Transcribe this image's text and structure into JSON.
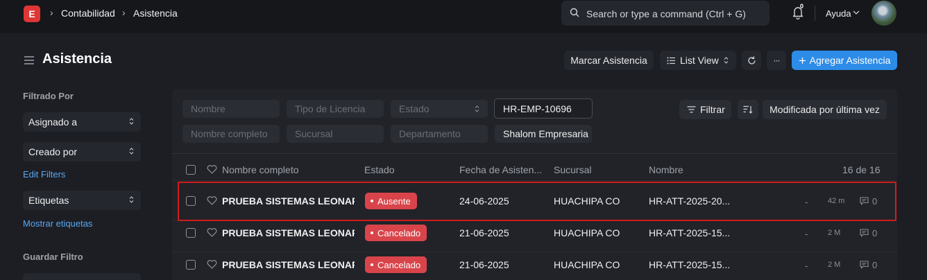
{
  "navbar": {
    "logo_letter": "E",
    "breadcrumbs": [
      "Contabilidad",
      "Asistencia"
    ],
    "search_placeholder": "Search or type a command (Ctrl + G)",
    "notification_count": "0",
    "help_label": "Ayuda"
  },
  "header": {
    "title": "Asistencia",
    "mark_attendance": "Marcar Asistencia",
    "view_label": "List View",
    "more_label": "···",
    "add_button": "Agregar Asistencia"
  },
  "sidebar": {
    "filtered_by": "Filtrado Por",
    "assigned_to": "Asignado a",
    "created_by": "Creado por",
    "edit_filters": "Edit Filters",
    "tags": "Etiquetas",
    "show_tags": "Mostrar etiquetas",
    "save_filter": "Guardar Filtro"
  },
  "filters": {
    "nombre": "Nombre",
    "tipo_licencia": "Tipo de Licencia",
    "estado": "Estado",
    "employee_value": "HR-EMP-10696",
    "nombre_completo": "Nombre completo",
    "sucursal": "Sucursal",
    "departamento": "Departamento",
    "company_value": "Shalom Empresaria",
    "filter_button": "Filtrar",
    "sort_label": "Modificada por última vez"
  },
  "table": {
    "headers": {
      "name": "Nombre completo",
      "status": "Estado",
      "date": "Fecha de Asisten...",
      "branch": "Sucursal",
      "id": "Nombre",
      "count": "16 de 16"
    },
    "rows": [
      {
        "name": "PRUEBA SISTEMAS LEONARDO",
        "status": "Ausente",
        "date": "24-06-2025",
        "branch": "HUACHIPA CO",
        "id": "HR-ATT-2025-20...",
        "dash": "-",
        "time": "42 m",
        "comments": "0"
      },
      {
        "name": "PRUEBA SISTEMAS LEONARDO",
        "status": "Cancelado",
        "date": "21-06-2025",
        "branch": "HUACHIPA CO",
        "id": "HR-ATT-2025-15...",
        "dash": "-",
        "time": "2 M",
        "comments": "0"
      },
      {
        "name": "PRUEBA SISTEMAS LEONARDO",
        "status": "Cancelado",
        "date": "21-06-2025",
        "branch": "HUACHIPA CO",
        "id": "HR-ATT-2025-15...",
        "dash": "-",
        "time": "2 M",
        "comments": "0"
      }
    ]
  },
  "colors": {
    "accent": "#2d8ce8",
    "danger": "#d9444a",
    "highlight_box": "#d11c1c"
  },
  "icons": [
    "search-icon",
    "bell-icon",
    "chevron-down-icon",
    "hamburger-icon",
    "list-icon",
    "refresh-icon",
    "plus-icon",
    "filter-icon",
    "sort-icon",
    "heart-icon",
    "comment-icon",
    "select-chevrons-icon"
  ]
}
